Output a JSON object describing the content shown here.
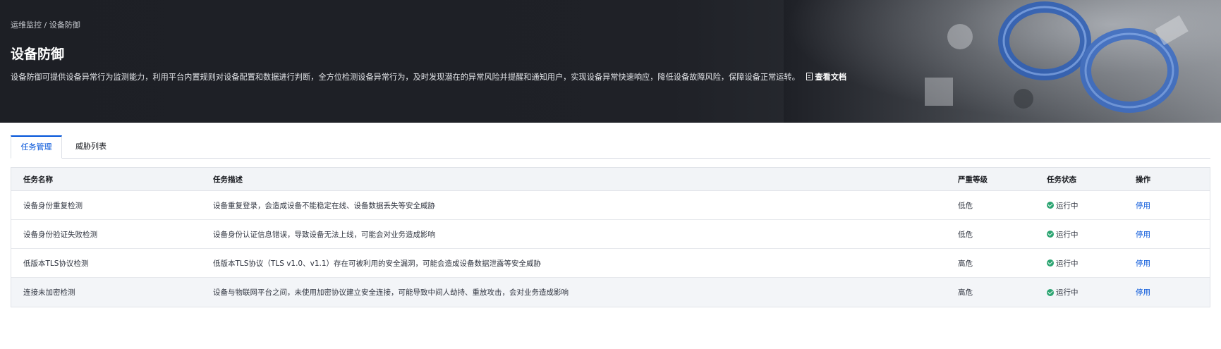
{
  "breadcrumb": {
    "parent": "运维监控",
    "separator": " / ",
    "current": "设备防御"
  },
  "header": {
    "title": "设备防御",
    "description": "设备防御可提供设备异常行为监测能力，利用平台内置规则对设备配置和数据进行判断，全方位检测设备异常行为，及时发现潜在的异常风险并提醒和通知用户，实现设备异常快速响应，降低设备故障风险，保障设备正常运转。",
    "doc_link": "查看文档"
  },
  "tabs": [
    {
      "label": "任务管理",
      "active": true
    },
    {
      "label": "威胁列表",
      "active": false
    }
  ],
  "table": {
    "columns": [
      "任务名称",
      "任务描述",
      "严重等级",
      "任务状态",
      "操作"
    ],
    "rows": [
      {
        "name": "设备身份重复检测",
        "desc": "设备重复登录，会造成设备不能稳定在线、设备数据丢失等安全威胁",
        "level": "低危",
        "status": "运行中",
        "action": "停用"
      },
      {
        "name": "设备身份验证失败检测",
        "desc": "设备身份认证信息错误，导致设备无法上线，可能会对业务造成影响",
        "level": "低危",
        "status": "运行中",
        "action": "停用"
      },
      {
        "name": "低版本TLS协议检测",
        "desc": "低版本TLS协议（TLS v1.0、v1.1）存在可被利用的安全漏洞，可能会造成设备数据泄露等安全威胁",
        "level": "高危",
        "status": "运行中",
        "action": "停用"
      },
      {
        "name": "连接未加密检测",
        "desc": "设备与物联网平台之间，未使用加密协议建立安全连接，可能导致中间人劫持、重放攻击，会对业务造成影响",
        "level": "高危",
        "status": "运行中",
        "action": "停用"
      }
    ]
  },
  "colors": {
    "accent": "#0052d9",
    "status_running": "#2ba471",
    "banner_bg": "#1d1f25"
  }
}
